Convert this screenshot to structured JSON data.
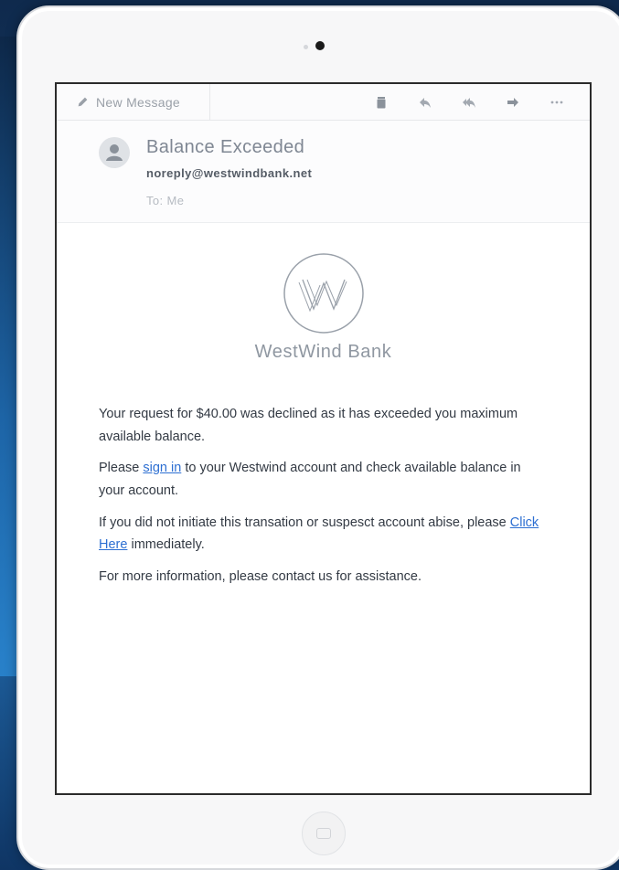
{
  "toolbar": {
    "compose_label": "New Message",
    "icons": [
      "trash-icon",
      "reply-icon",
      "reply-all-icon",
      "forward-icon",
      "more-icon"
    ]
  },
  "email": {
    "subject": "Balance Exceeded",
    "from": "noreply@westwindbank.net",
    "to": "To: Me"
  },
  "brand": {
    "name": "WestWind Bank",
    "accent": "#8f97a1"
  },
  "message": {
    "p1": "Your request for $40.00 was declined as it has exceeded you maximum available balance.",
    "p2_before": "Please ",
    "p2_link": "sign in",
    "p2_after": " to your Westwind account and check available balance in your account.",
    "p3_before": "If you did not initiate this transation or suspesct account abise, please ",
    "p3_link": "Click Here",
    "p3_after": " immediately.",
    "p4": "For more information, please contact us for assistance."
  },
  "colors": {
    "link": "#2d6fd2",
    "frame": "#2b2b2b"
  }
}
